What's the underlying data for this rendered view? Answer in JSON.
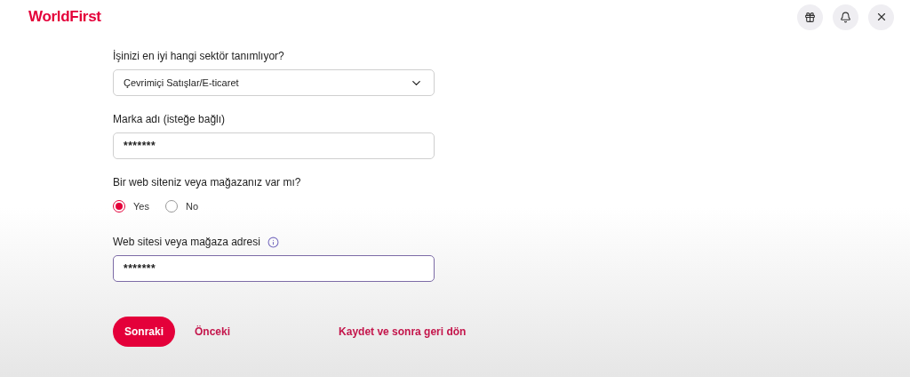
{
  "header": {
    "logo": "WorldFirst"
  },
  "form": {
    "fields": [
      {
        "kind": "select",
        "label": "İşinizi en iyi hangi sektör tanımlıyor?",
        "value": "Çevrimiçi Satışlar/E-ticaret",
        "focused": false
      },
      {
        "kind": "text",
        "label": "Marka adı (isteğe bağlı)",
        "value": "*******",
        "focused": false
      },
      {
        "kind": "radio",
        "label": "Bir web siteniz veya mağazanız var mı?",
        "options": [
          {
            "label": "Yes",
            "selected": true
          },
          {
            "label": "No",
            "selected": false
          }
        ]
      },
      {
        "kind": "text",
        "label": "Web sitesi veya mağaza adresi",
        "info": true,
        "value": "*******",
        "focused": true
      }
    ]
  },
  "actions": {
    "next": "Sonraki",
    "back": "Önceki",
    "save": "Kaydet ve sonra geri dön"
  }
}
